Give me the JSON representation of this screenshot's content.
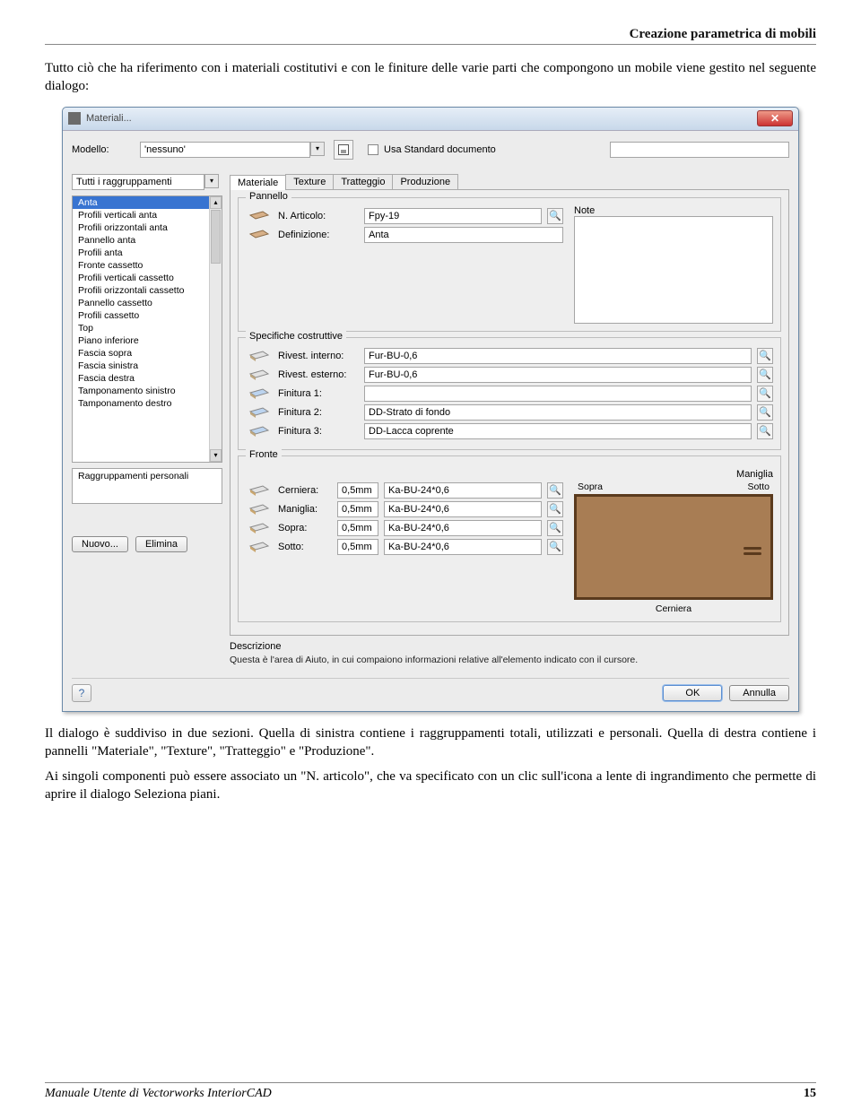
{
  "doc": {
    "header": "Creazione parametrica di mobili",
    "intro": "Tutto ciò che ha riferimento con i materiali costitutivi e con le finiture delle varie parti che compongono un mobile viene gestito nel seguente dialogo:",
    "p1": "Il dialogo è suddiviso in due sezioni. Quella di sinistra contiene i raggruppamenti totali, utilizzati e personali. Quella di destra contiene i pannelli \"Materiale\", \"Texture\", \"Tratteggio\" e \"Produzione\".",
    "p2": "Ai singoli componenti può essere associato un \"N. articolo\", che va specificato con un clic sull'icona a lente di ingrandimento che permette di aprire il dialogo Seleziona piani.",
    "footer_title": "Manuale Utente di Vectorworks InteriorCAD",
    "page_number": "15"
  },
  "dialog": {
    "title": "Materiali...",
    "top": {
      "model_label": "Modello:",
      "model_value": "'nessuno'",
      "use_std_label": "Usa Standard documento"
    },
    "left": {
      "groups_combo": "Tutti i raggruppamenti",
      "items": [
        "Anta",
        "Profili verticali anta",
        "Profili orizzontali anta",
        "Pannello anta",
        "Profili anta",
        "Fronte cassetto",
        "Profili verticali cassetto",
        "Profili orizzontali cassetto",
        "Pannello cassetto",
        "Profili cassetto",
        "Top",
        "Piano inferiore",
        "Fascia sopra",
        "Fascia sinistra",
        "Fascia destra",
        "Tamponamento sinistro",
        "Tamponamento destro"
      ],
      "selected_index": 0,
      "personal_label": "Raggruppamenti personali",
      "btn_new": "Nuovo...",
      "btn_delete": "Elimina"
    },
    "tabs": [
      "Materiale",
      "Texture",
      "Tratteggio",
      "Produzione"
    ],
    "active_tab": 0,
    "pannello": {
      "legend": "Pannello",
      "n_articolo_label": "N. Articolo:",
      "n_articolo_value": "Fpy-19",
      "definizione_label": "Definizione:",
      "definizione_value": "Anta",
      "note_label": "Note"
    },
    "specifiche": {
      "legend": "Specifiche costruttive",
      "rows": [
        {
          "label": "Rivest. interno:",
          "value": "Fur-BU-0,6"
        },
        {
          "label": "Rivest. esterno:",
          "value": "Fur-BU-0,6"
        },
        {
          "label": "Finitura 1:",
          "value": ""
        },
        {
          "label": "Finitura 2:",
          "value": "DD-Strato di fondo"
        },
        {
          "label": "Finitura 3:",
          "value": "DD-Lacca coprente"
        }
      ]
    },
    "fronte": {
      "legend": "Fronte",
      "rows": [
        {
          "label": "Cerniera:",
          "offset": "0,5mm",
          "value": "Ka-BU-24*0,6"
        },
        {
          "label": "Maniglia:",
          "offset": "0,5mm",
          "value": "Ka-BU-24*0,6"
        },
        {
          "label": "Sopra:",
          "offset": "0,5mm",
          "value": "Ka-BU-24*0,6"
        },
        {
          "label": "Sotto:",
          "offset": "0,5mm",
          "value": "Ka-BU-24*0,6"
        }
      ],
      "preview_title": "Maniglia",
      "pv_left": "Sopra",
      "pv_right": "Sotto",
      "pv_bottom": "Cerniera"
    },
    "descrizione": {
      "title": "Descrizione",
      "text": "Questa è l'area di Aiuto, in cui compaiono informazioni relative all'elemento indicato con il cursore."
    },
    "footer": {
      "ok": "OK",
      "cancel": "Annulla"
    }
  }
}
